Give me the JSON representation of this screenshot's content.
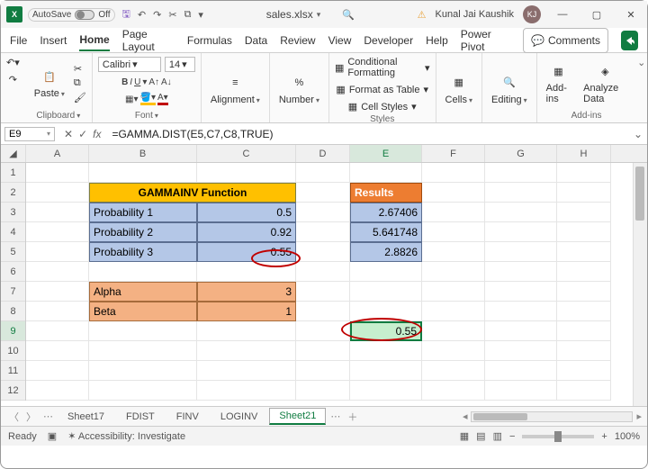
{
  "title_bar": {
    "autosave_label": "AutoSave",
    "autosave_state": "Off",
    "filename": "sales.xlsx",
    "search_icon": "search",
    "user_name": "Kunal Jai Kaushik",
    "user_initials": "KJ"
  },
  "menu": {
    "tabs": [
      "File",
      "Insert",
      "Home",
      "Page Layout",
      "Formulas",
      "Data",
      "Review",
      "View",
      "Developer",
      "Help",
      "Power Pivot"
    ],
    "active": "Home",
    "comments_label": "Comments"
  },
  "ribbon": {
    "clipboard": {
      "paste": "Paste",
      "label": "Clipboard"
    },
    "font": {
      "name": "Calibri",
      "size": "14",
      "label": "Font"
    },
    "alignment": {
      "btn": "Alignment"
    },
    "number": {
      "btn": "Number"
    },
    "styles": {
      "cond": "Conditional Formatting",
      "table": "Format as Table",
      "cell": "Cell Styles",
      "label": "Styles"
    },
    "cells": {
      "btn": "Cells"
    },
    "editing": {
      "btn": "Editing"
    },
    "addins": {
      "btn": "Add-ins",
      "analyze": "Analyze Data",
      "label": "Add-ins"
    }
  },
  "formula_bar": {
    "name_box": "E9",
    "formula": "=GAMMA.DIST(E5,C7,C8,TRUE)"
  },
  "columns": [
    "A",
    "B",
    "C",
    "D",
    "E",
    "F",
    "G",
    "H"
  ],
  "rows": [
    "1",
    "2",
    "3",
    "4",
    "5",
    "6",
    "7",
    "8",
    "9",
    "10",
    "11",
    "12"
  ],
  "cells": {
    "B2C2": "GAMMAINV Function",
    "E2": "Results",
    "B3": "Probability 1",
    "C3": "0.5",
    "E3": "2.67406",
    "B4": "Probability 2",
    "C4": "0.92",
    "E4": "5.641748",
    "B5": "Probability 3",
    "C5": "0.55",
    "E5": "2.8826",
    "B7": "Alpha",
    "C7": "3",
    "B8": "Beta",
    "C8": "1",
    "E9": "0.55"
  },
  "sheet_tabs": {
    "tabs": [
      "Sheet17",
      "FDIST",
      "FINV",
      "LOGINV",
      "Sheet21"
    ],
    "active": "Sheet21"
  },
  "status_bar": {
    "ready": "Ready",
    "access": "Accessibility: Investigate",
    "zoom": "100%"
  }
}
